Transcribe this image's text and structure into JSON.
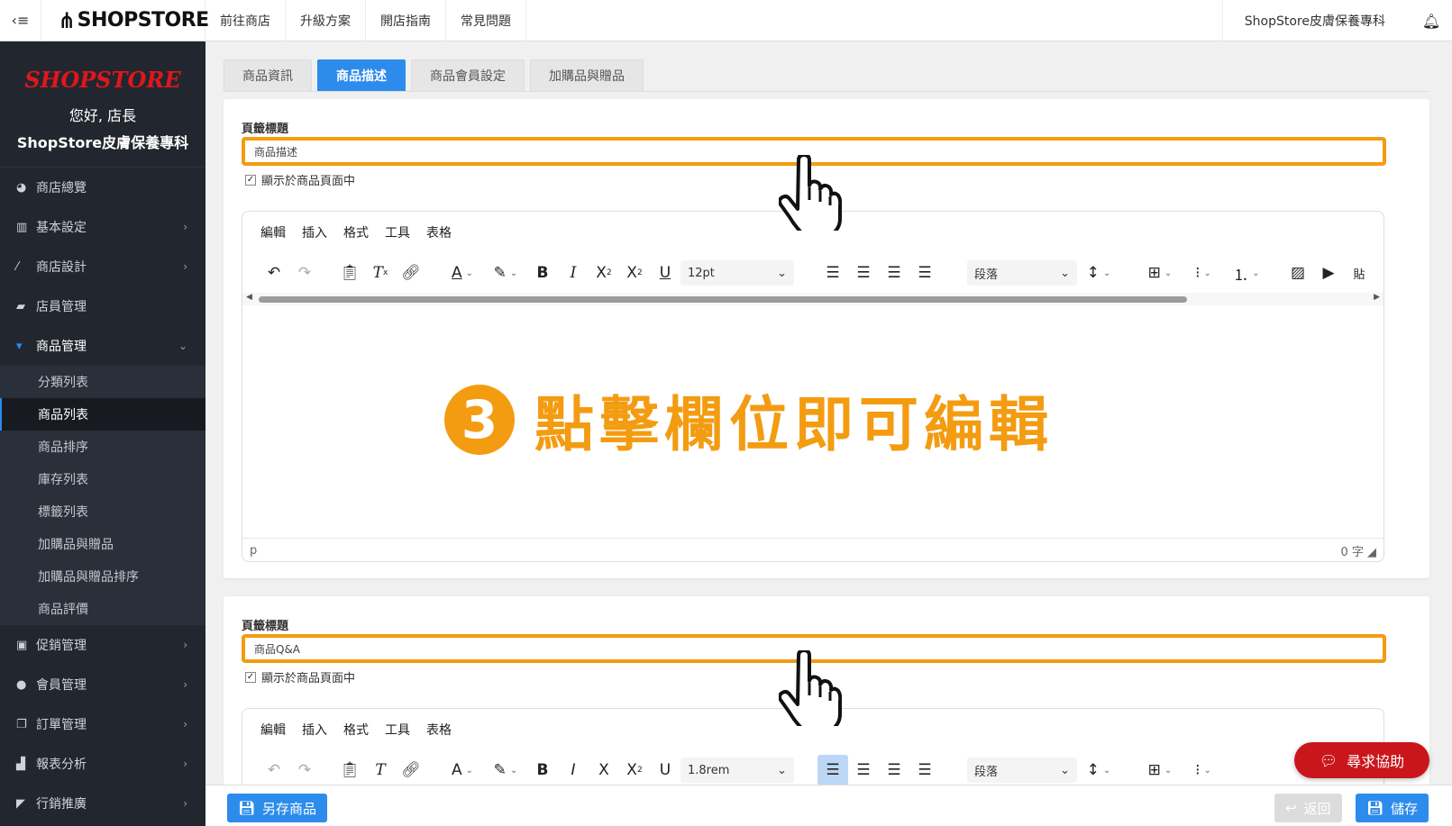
{
  "topbar": {
    "brand": "SHOPSTORE",
    "nav": [
      "前往商店",
      "升級方案",
      "開店指南",
      "常見問題"
    ],
    "store_name": "ShopStore皮膚保養專科"
  },
  "sidebar": {
    "logo": "SHOPSTORE",
    "greeting": "您好, 店長",
    "store_name": "ShopStore皮膚保養專科",
    "items_top": [
      {
        "label": "商店總覽",
        "icon": "dashboard-icon"
      },
      {
        "label": "基本設定",
        "icon": "bank-icon"
      },
      {
        "label": "商店設計",
        "icon": "magic-wand-icon"
      },
      {
        "label": "店員管理",
        "icon": "lock-icon"
      },
      {
        "label": "商品管理",
        "icon": "cart-icon"
      }
    ],
    "sub_items": [
      "分類列表",
      "商品列表",
      "商品排序",
      "庫存列表",
      "標籤列表",
      "加購品與贈品",
      "加購品與贈品排序",
      "商品評價"
    ],
    "items_bottom": [
      {
        "label": "促銷管理",
        "icon": "gift-icon"
      },
      {
        "label": "會員管理",
        "icon": "users-icon"
      },
      {
        "label": "訂單管理",
        "icon": "copy-icon"
      },
      {
        "label": "報表分析",
        "icon": "bar-chart-icon"
      },
      {
        "label": "行銷推廣",
        "icon": "paper-plane-icon"
      }
    ]
  },
  "tabs": [
    "商品資訊",
    "商品描述",
    "商品會員設定",
    "加購品與贈品"
  ],
  "section1": {
    "label": "頁籤標題",
    "value": "商品描述",
    "checkbox_label": "顯示於商品頁面中"
  },
  "section2": {
    "label": "頁籤標題",
    "value": "商品Q&A",
    "checkbox_label": "顯示於商品頁面中"
  },
  "editor": {
    "menus": [
      "編輯",
      "插入",
      "格式",
      "工具",
      "表格"
    ],
    "font_size": "12pt",
    "font_size_2": "1.8rem",
    "block_format": "段落",
    "paste_text": "貼",
    "status_path": "p",
    "word_count": "0 字"
  },
  "annotation": {
    "step": "3",
    "text": "點擊欄位即可編輯",
    "color": "#f39c12"
  },
  "buttons": {
    "save_as": "另存商品",
    "back": "返回",
    "save": "儲存",
    "help": "尋求協助"
  },
  "colors": {
    "primary": "#2d8ceb",
    "sidebar": "#22272f",
    "highlight": "#f39c12",
    "help": "#c9161c"
  }
}
